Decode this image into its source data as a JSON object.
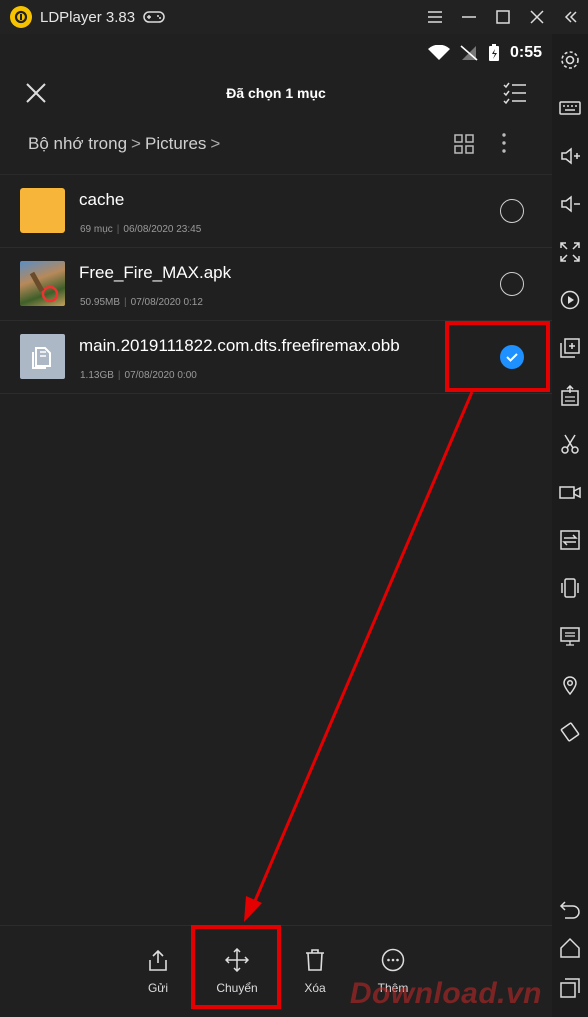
{
  "window": {
    "title": "LDPlayer 3.83"
  },
  "status": {
    "time": "0:55"
  },
  "appbar": {
    "title": "Đã chọn 1 mục"
  },
  "breadcrumb": {
    "root": "Bộ nhớ trong",
    "sep1": ">",
    "folder": "Pictures",
    "sep2": ">"
  },
  "files": [
    {
      "name": "cache",
      "size": "69 mục",
      "date": "06/08/2020 23:45",
      "selected": false
    },
    {
      "name": "Free_Fire_MAX.apk",
      "size": "50.95MB",
      "date": "07/08/2020 0:12",
      "selected": false
    },
    {
      "name": "main.2019111822.com.dts.freefiremax.obb",
      "size": "1.13GB",
      "date": "07/08/2020 0:00",
      "selected": true
    }
  ],
  "meta_sep": "|",
  "bottombar": {
    "send": "Gửi",
    "move": "Chuyển",
    "delete": "Xóa",
    "more": "Thêm"
  },
  "watermark": "Download.vn",
  "colors": {
    "accent": "#1e90ff",
    "highlight": "#e40000",
    "folder": "#f7b63a"
  }
}
